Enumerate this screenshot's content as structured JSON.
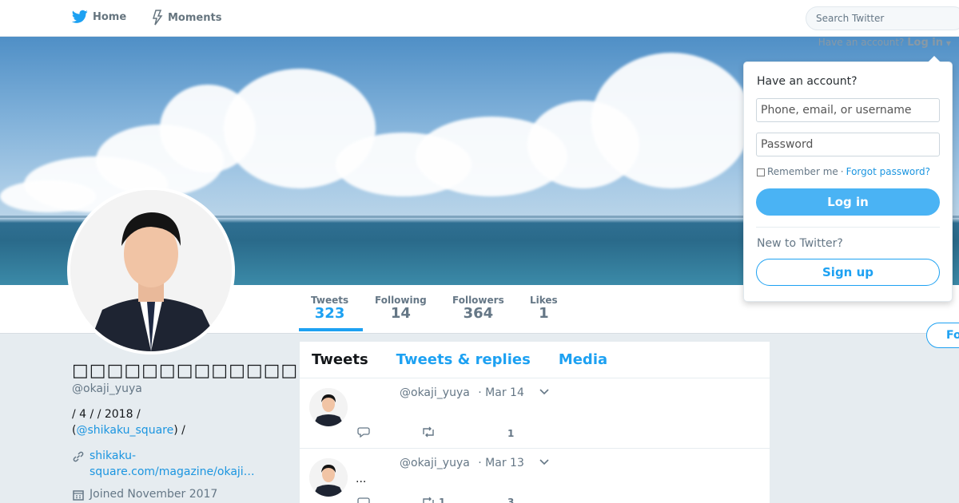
{
  "nav": {
    "home_label": "Home",
    "moments_label": "Moments",
    "search_placeholder": "Search Twitter",
    "home_icon": "twitter-bird-icon",
    "moments_icon": "lightning-icon"
  },
  "login_hint": {
    "text": "Have an account?",
    "link": "Log in"
  },
  "login_dropdown": {
    "title": "Have an account?",
    "username_placeholder": "Phone, email, or username",
    "password_placeholder": "Password",
    "remember_label": "Remember me",
    "separator": "·",
    "forgot_label": "Forgot password?",
    "login_button": "Log in",
    "new_label": "New to Twitter?",
    "signup_button": "Sign up"
  },
  "stats": [
    {
      "label": "Tweets",
      "value": "323"
    },
    {
      "label": "Following",
      "value": "14"
    },
    {
      "label": "Followers",
      "value": "364"
    },
    {
      "label": "Likes",
      "value": "1"
    }
  ],
  "follow_button": "Fo",
  "profile": {
    "display_name": "□□□□□□□□□□□□□□□□□□□□",
    "handle": "@okaji_yuya",
    "bio_line1": " / 4 /  / 2018 /",
    "bio_line2_prefix": "(",
    "bio_mention": "@shikaku_square",
    "bio_line2_suffix": ") /",
    "link": "shikaku-square.com/magazine/okaji…",
    "joined": "Joined November 2017"
  },
  "timeline": {
    "tabs": [
      "Tweets",
      "Tweets & replies",
      "Media"
    ],
    "tweets": [
      {
        "handle": "@okaji_yuya",
        "date": "· Mar 14",
        "body": "",
        "replies": "",
        "retweets": "",
        "likes": "1"
      },
      {
        "handle": "@okaji_yuya",
        "date": "· Mar 13",
        "body": "...",
        "replies": "",
        "retweets": "1",
        "likes": "3"
      }
    ]
  },
  "colors": {
    "accent": "#1da1f2",
    "button": "#4ab3f4",
    "background": "#e6ecf0"
  }
}
